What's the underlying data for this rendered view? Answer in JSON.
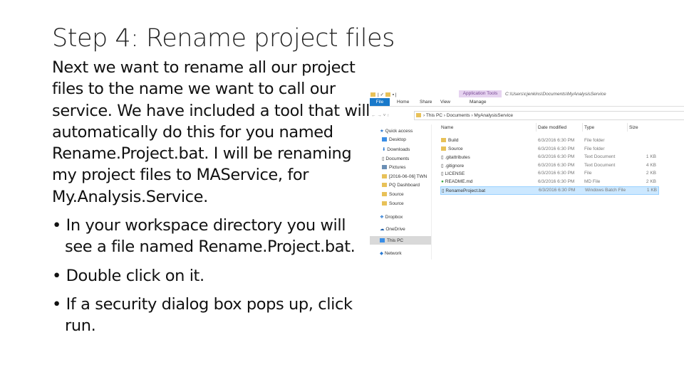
{
  "slide": {
    "title": "Step 4: Rename project files",
    "intro": "Next we want to rename all our project files to the name we want to call our service.  We have included a tool that will automatically do this for you named Rename.Project.bat.  I will be renaming my project files to MAService, for My.Analysis.Service.",
    "bullets": [
      "In your workspace directory you will see a file named Rename.Project.bat.",
      "Double click on it.",
      "If a security dialog box pops up, click run."
    ]
  },
  "explorer": {
    "context_tab": "Application Tools",
    "path_title": "C:\\Users\\cjenkins\\Documents\\MyAnalysisService",
    "tabs": [
      "File",
      "Home",
      "Share",
      "View",
      "Manage"
    ],
    "breadcrumb": [
      "This PC",
      "Documents",
      "MyAnalysisService"
    ],
    "columns": [
      "Name",
      "Date modified",
      "Type",
      "Size"
    ],
    "files": [
      {
        "name": "Build",
        "date": "6/3/2016 6:30 PM",
        "type": "File folder",
        "size": ""
      },
      {
        "name": "Source",
        "date": "6/3/2016 6:30 PM",
        "type": "File folder",
        "size": ""
      },
      {
        "name": ".gitattributes",
        "date": "6/3/2016 6:30 PM",
        "type": "Text Document",
        "size": "1 KB"
      },
      {
        "name": ".gitignore",
        "date": "6/3/2016 6:30 PM",
        "type": "Text Document",
        "size": "4 KB"
      },
      {
        "name": "LICENSE",
        "date": "6/3/2016 6:30 PM",
        "type": "File",
        "size": "2 KB"
      },
      {
        "name": "README.md",
        "date": "6/3/2016 6:30 PM",
        "type": "MD File",
        "size": "2 KB"
      },
      {
        "name": "RenameProject.bat",
        "date": "6/3/2016 6:30 PM",
        "type": "Windows Batch File",
        "size": "1 KB"
      }
    ],
    "sidebar": [
      "Quick access",
      "Desktop",
      "Downloads",
      "Documents",
      "Pictures",
      "[2016-06-06] TWN",
      "PQ Dashboard",
      "Source",
      "Source",
      "Dropbox",
      "OneDrive",
      "This PC",
      "Network"
    ]
  }
}
